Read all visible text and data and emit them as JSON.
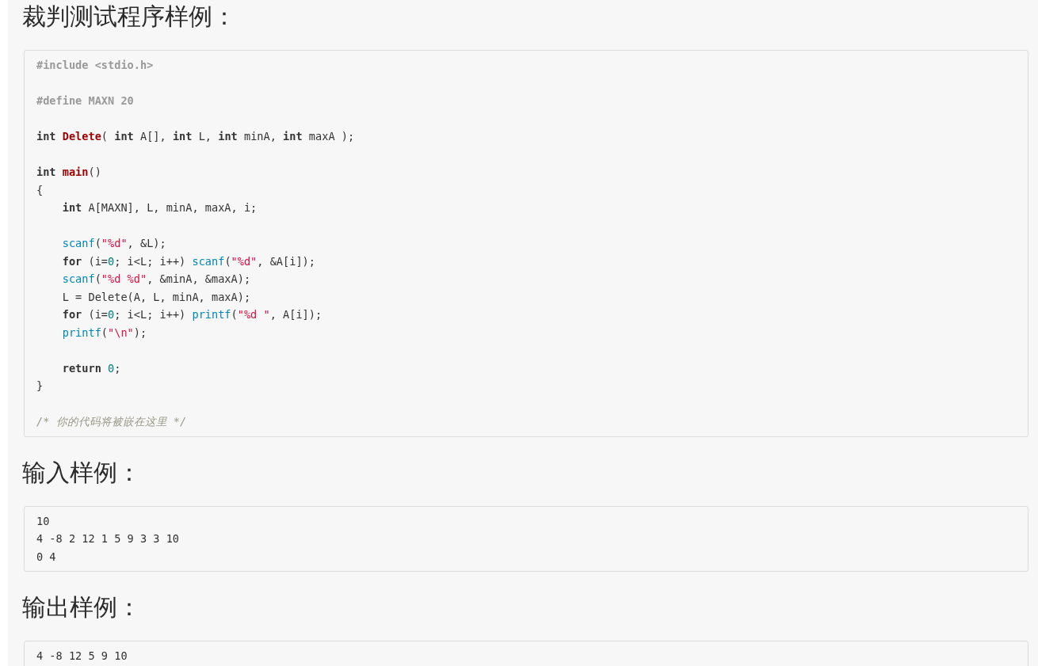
{
  "sections": [
    {
      "heading": "裁判测试程序样例：",
      "block": {
        "kind": "source",
        "stanzas": [
          [
            [
              {
                "kind": "meta",
                "text": "#include <stdio.h>"
              }
            ]
          ],
          [
            [
              {
                "kind": "meta",
                "text": "#define MAXN 20"
              }
            ]
          ],
          [
            [
              {
                "kind": "keyword",
                "text": "int "
              },
              {
                "kind": "title",
                "text": "Delete"
              },
              {
                "kind": "plain",
                "text": "( "
              },
              {
                "kind": "keyword",
                "text": "int"
              },
              {
                "kind": "plain",
                "text": " A[], "
              },
              {
                "kind": "keyword",
                "text": "int"
              },
              {
                "kind": "plain",
                "text": " L, "
              },
              {
                "kind": "keyword",
                "text": "int"
              },
              {
                "kind": "plain",
                "text": " minA, "
              },
              {
                "kind": "keyword",
                "text": "int"
              },
              {
                "kind": "plain",
                "text": " maxA );"
              }
            ]
          ],
          [
            [
              {
                "kind": "keyword",
                "text": "int "
              },
              {
                "kind": "title",
                "text": "main"
              },
              {
                "kind": "plain",
                "text": "()"
              }
            ],
            [
              {
                "kind": "plain",
                "text": "{"
              }
            ],
            [
              {
                "kind": "keyword",
                "text": "    int"
              },
              {
                "kind": "plain",
                "text": " A[MAXN], L, minA, maxA, i;"
              }
            ]
          ],
          [
            [
              {
                "kind": "builtin",
                "text": "    scanf"
              },
              {
                "kind": "plain",
                "text": "("
              },
              {
                "kind": "string",
                "text": "\"%d\""
              },
              {
                "kind": "plain",
                "text": ", &L);"
              }
            ],
            [
              {
                "kind": "keyword",
                "text": "    for"
              },
              {
                "kind": "plain",
                "text": " (i="
              },
              {
                "kind": "number",
                "text": "0"
              },
              {
                "kind": "plain",
                "text": "; i<L; i++) "
              },
              {
                "kind": "builtin",
                "text": "scanf"
              },
              {
                "kind": "plain",
                "text": "("
              },
              {
                "kind": "string",
                "text": "\"%d\""
              },
              {
                "kind": "plain",
                "text": ", &A[i]);"
              }
            ],
            [
              {
                "kind": "builtin",
                "text": "    scanf"
              },
              {
                "kind": "plain",
                "text": "("
              },
              {
                "kind": "string",
                "text": "\"%d %d\""
              },
              {
                "kind": "plain",
                "text": ", &minA, &maxA);"
              }
            ],
            [
              {
                "kind": "plain",
                "text": "    L = Delete(A, L, minA, maxA);"
              }
            ],
            [
              {
                "kind": "keyword",
                "text": "    for"
              },
              {
                "kind": "plain",
                "text": " (i="
              },
              {
                "kind": "number",
                "text": "0"
              },
              {
                "kind": "plain",
                "text": "; i<L; i++) "
              },
              {
                "kind": "builtin",
                "text": "printf"
              },
              {
                "kind": "plain",
                "text": "("
              },
              {
                "kind": "string",
                "text": "\"%d \""
              },
              {
                "kind": "plain",
                "text": ", A[i]);"
              }
            ],
            [
              {
                "kind": "builtin",
                "text": "    printf"
              },
              {
                "kind": "plain",
                "text": "("
              },
              {
                "kind": "string",
                "text": "\"\\n\""
              },
              {
                "kind": "plain",
                "text": ");"
              }
            ]
          ],
          [
            [
              {
                "kind": "keyword",
                "text": "    return "
              },
              {
                "kind": "number",
                "text": "0"
              },
              {
                "kind": "plain",
                "text": ";"
              }
            ],
            [
              {
                "kind": "plain",
                "text": "}"
              }
            ]
          ],
          [
            [
              {
                "kind": "comment",
                "text": "/* 你的代码将被嵌在这里 */"
              }
            ]
          ]
        ]
      }
    },
    {
      "heading": "输入样例：",
      "block": {
        "kind": "plain",
        "lines": [
          "10",
          "4 -8 2 12 1 5 9 3 3 10",
          "0 4"
        ]
      }
    },
    {
      "heading": "输出样例：",
      "block": {
        "kind": "plain",
        "lines": [
          "4 -8 12 5 9 10"
        ]
      }
    }
  ]
}
